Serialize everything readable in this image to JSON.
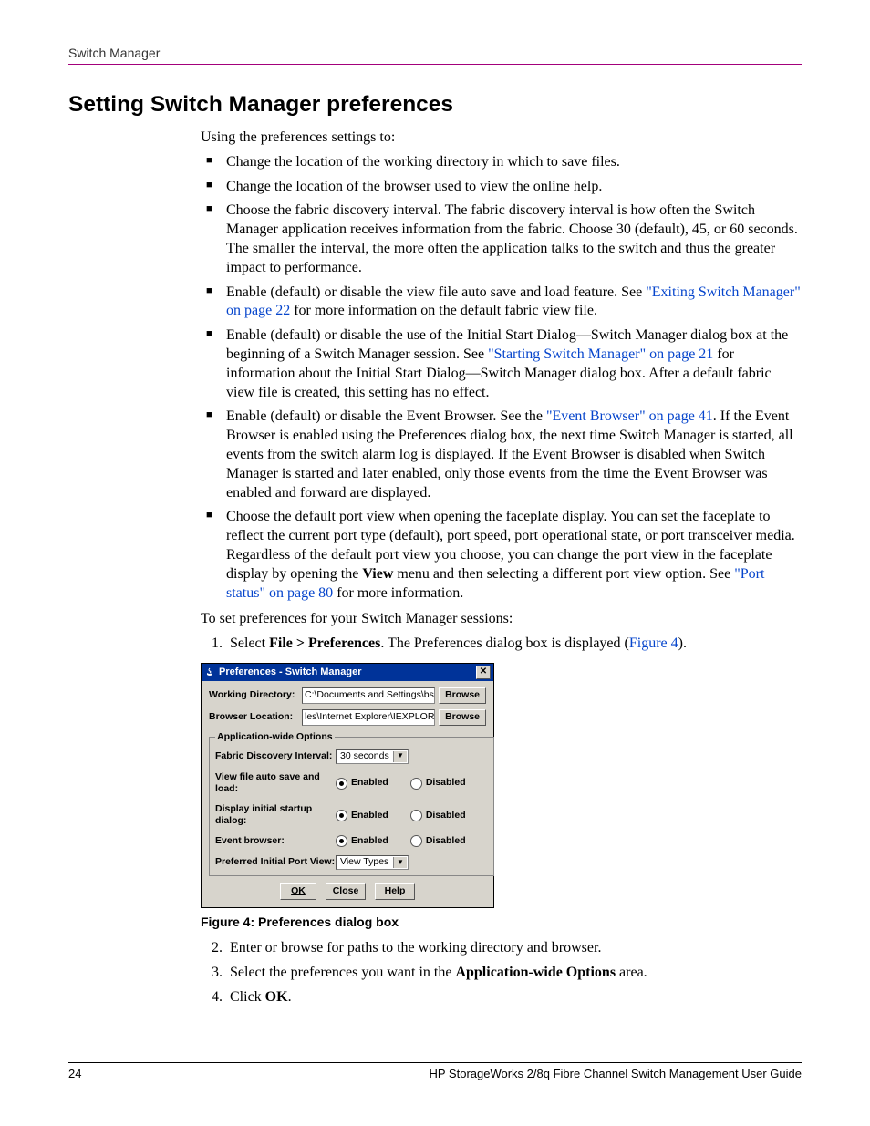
{
  "header": "Switch Manager",
  "title": "Setting Switch Manager preferences",
  "intro": "Using the preferences settings to:",
  "bullets": {
    "b1": "Change the location of the working directory in which to save files.",
    "b2": "Change the location of the browser used to view the online help.",
    "b3": "Choose the fabric discovery interval. The fabric discovery interval is how often the Switch Manager application receives information from the fabric. Choose 30 (default), 45, or 60 seconds. The smaller the interval, the more often the application talks to the switch and thus the greater impact to performance.",
    "b4a": "Enable (default) or disable the view file auto save and load feature. See ",
    "b4link": "\"Exiting Switch Manager\" on page 22",
    "b4b": " for more information on the default fabric view file.",
    "b5a": "Enable (default) or disable the use of the Initial Start Dialog—Switch Manager dialog box at the beginning of a Switch Manager session. See ",
    "b5link": "\"Starting Switch Manager\" on page 21",
    "b5b": " for information about the Initial Start Dialog—Switch Manager dialog box. After a default fabric view file is created, this setting has no effect.",
    "b6a": "Enable (default) or disable the Event Browser. See the ",
    "b6link": "\"Event Browser\" on page 41",
    "b6b": ". If the Event Browser is enabled using the Preferences dialog box, the next time Switch Manager is started, all events from the switch alarm log is displayed. If the Event Browser is disabled when Switch Manager is started and later enabled, only those events from the time the Event Browser was enabled and forward are displayed.",
    "b7a": "Choose the default port view when opening the faceplate display. You can set the faceplate to reflect the current port type (default), port speed, port operational state, or port transceiver media. Regardless of the default port view you choose, you can change the port view in the faceplate display by opening the ",
    "b7bold": "View",
    "b7b": " menu and then selecting a different port view option. See ",
    "b7link": "\"Port status\" on page 80",
    "b7c": " for more information."
  },
  "proc_intro": "To set preferences for your Switch Manager sessions:",
  "steps": {
    "s1a": "Select ",
    "s1bold": "File > Preferences",
    "s1b": ". The Preferences dialog box is displayed (",
    "s1link": "Figure 4",
    "s1c": ").",
    "s2": "Enter or browse for paths to the working directory and browser.",
    "s3a": "Select the preferences you want in the ",
    "s3bold": "Application-wide Options",
    "s3b": " area.",
    "s4a": "Click ",
    "s4bold": "OK",
    "s4b": "."
  },
  "dialog": {
    "title": "Preferences - Switch Manager",
    "wd_label": "Working Directory:",
    "wd_value": "C:\\Documents and Settings\\bsmith",
    "bl_label": "Browser Location:",
    "bl_value": "les\\Internet Explorer\\IEXPLORE.EXE",
    "browse": "Browse",
    "legend": "Application-wide Options",
    "fdi_label": "Fabric Discovery Interval:",
    "fdi_value": "30 seconds",
    "vfas_label": "View file auto save and load:",
    "disd_label": "Display initial startup dialog:",
    "eb_label": "Event browser:",
    "pipv_label": "Preferred Initial Port View:",
    "pipv_value": "View Types",
    "enabled": "Enabled",
    "disabled": "Disabled",
    "ok": "OK",
    "close": "Close",
    "help": "Help"
  },
  "caption": "Figure 4:  Preferences dialog box",
  "footer": {
    "page": "24",
    "doc": "HP StorageWorks 2/8q Fibre Channel Switch Management User Guide"
  }
}
